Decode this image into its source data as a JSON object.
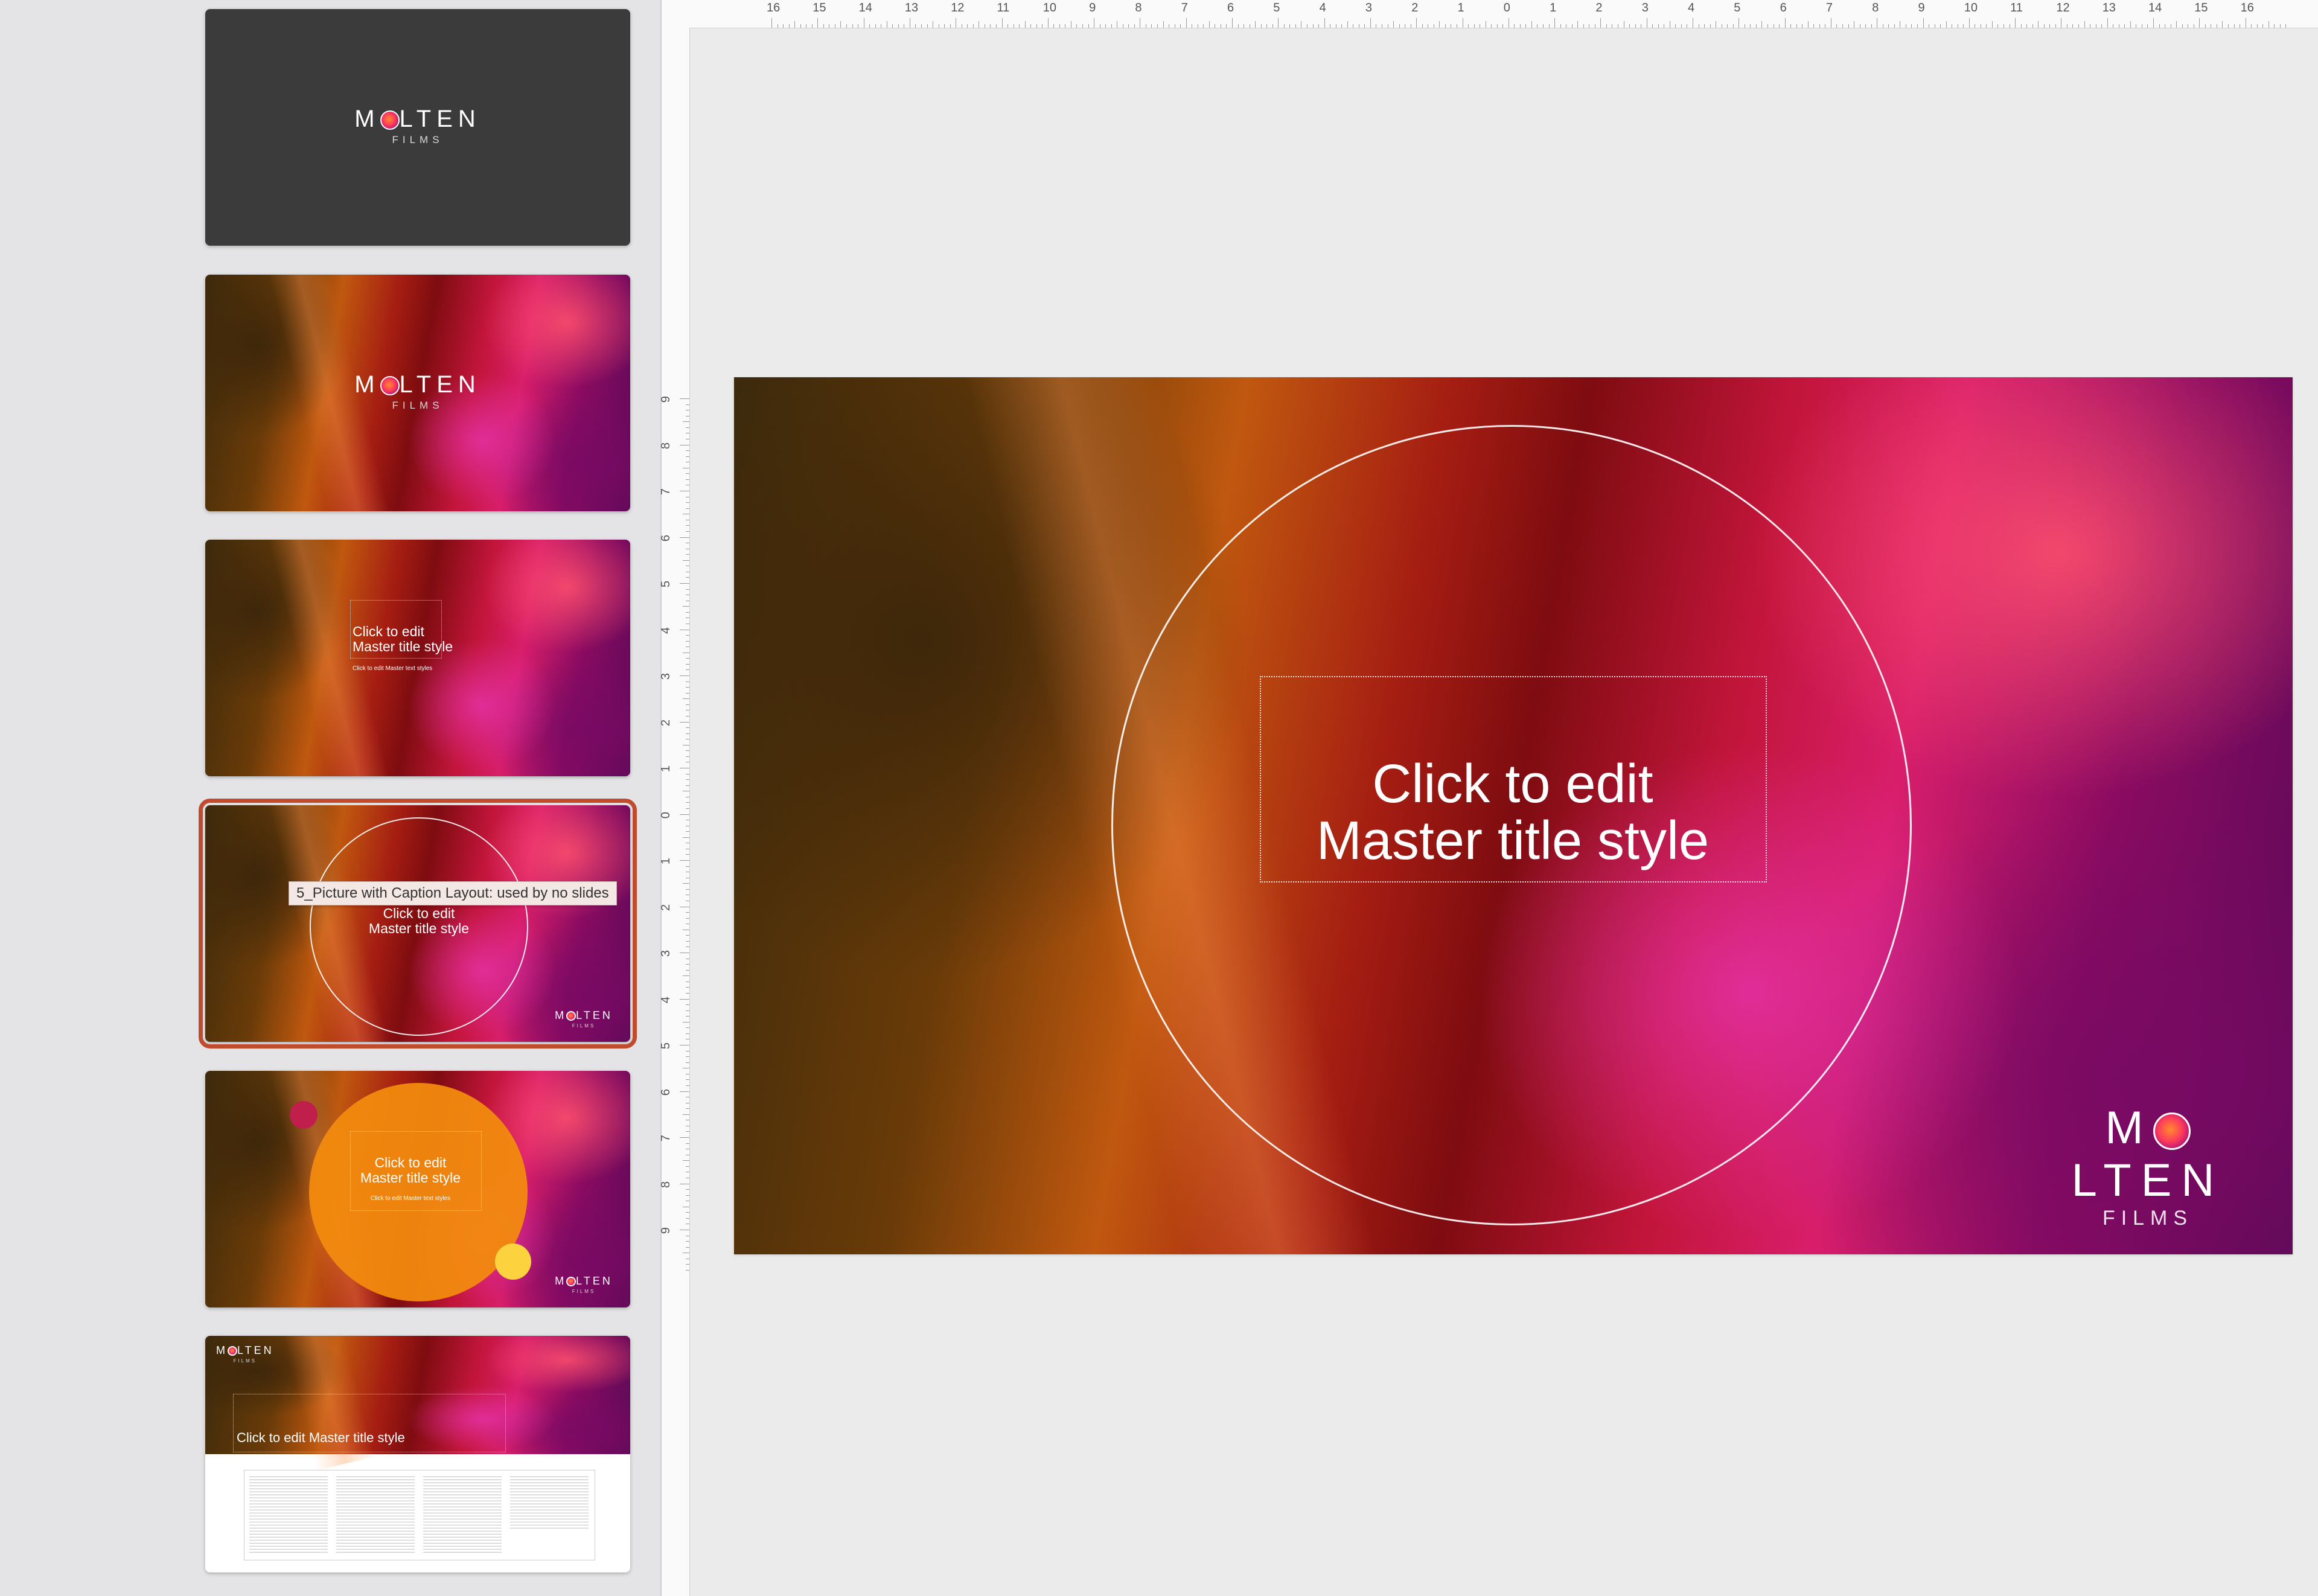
{
  "brand": {
    "logo_text": "MOLTEN",
    "logo_sub": "FILMS"
  },
  "thumbnails": [
    {
      "label": ""
    },
    {
      "label": ""
    },
    {
      "title": "Click to edit\nMaster title style",
      "text": "Click to edit Master text styles"
    },
    {
      "title": "Click to edit\nMaster title style"
    },
    {
      "title": "Click to edit\nMaster title style",
      "text": "Click to edit Master text styles"
    },
    {
      "title": "Click to edit Master title style"
    }
  ],
  "tooltip": "5_Picture with Caption Layout: used by no slides",
  "ruler": {
    "horizontal": [
      "16",
      "15",
      "14",
      "13",
      "12",
      "11",
      "10",
      "9",
      "8",
      "7",
      "6",
      "5",
      "4",
      "3",
      "2",
      "1",
      "0",
      "1",
      "2",
      "3",
      "4",
      "5",
      "6",
      "7",
      "8",
      "9",
      "10",
      "11",
      "12",
      "13",
      "14",
      "15",
      "16"
    ],
    "vertical": [
      "9",
      "8",
      "7",
      "6",
      "5",
      "4",
      "3",
      "2",
      "1",
      "0",
      "1",
      "2",
      "3",
      "4",
      "5",
      "6",
      "7",
      "8",
      "9"
    ]
  },
  "slide": {
    "title": "Click to edit\nMaster title style"
  },
  "colors": {
    "selection": "#c14b2d",
    "pane": "#e4e4e6",
    "canvas": "#ebebeb"
  }
}
